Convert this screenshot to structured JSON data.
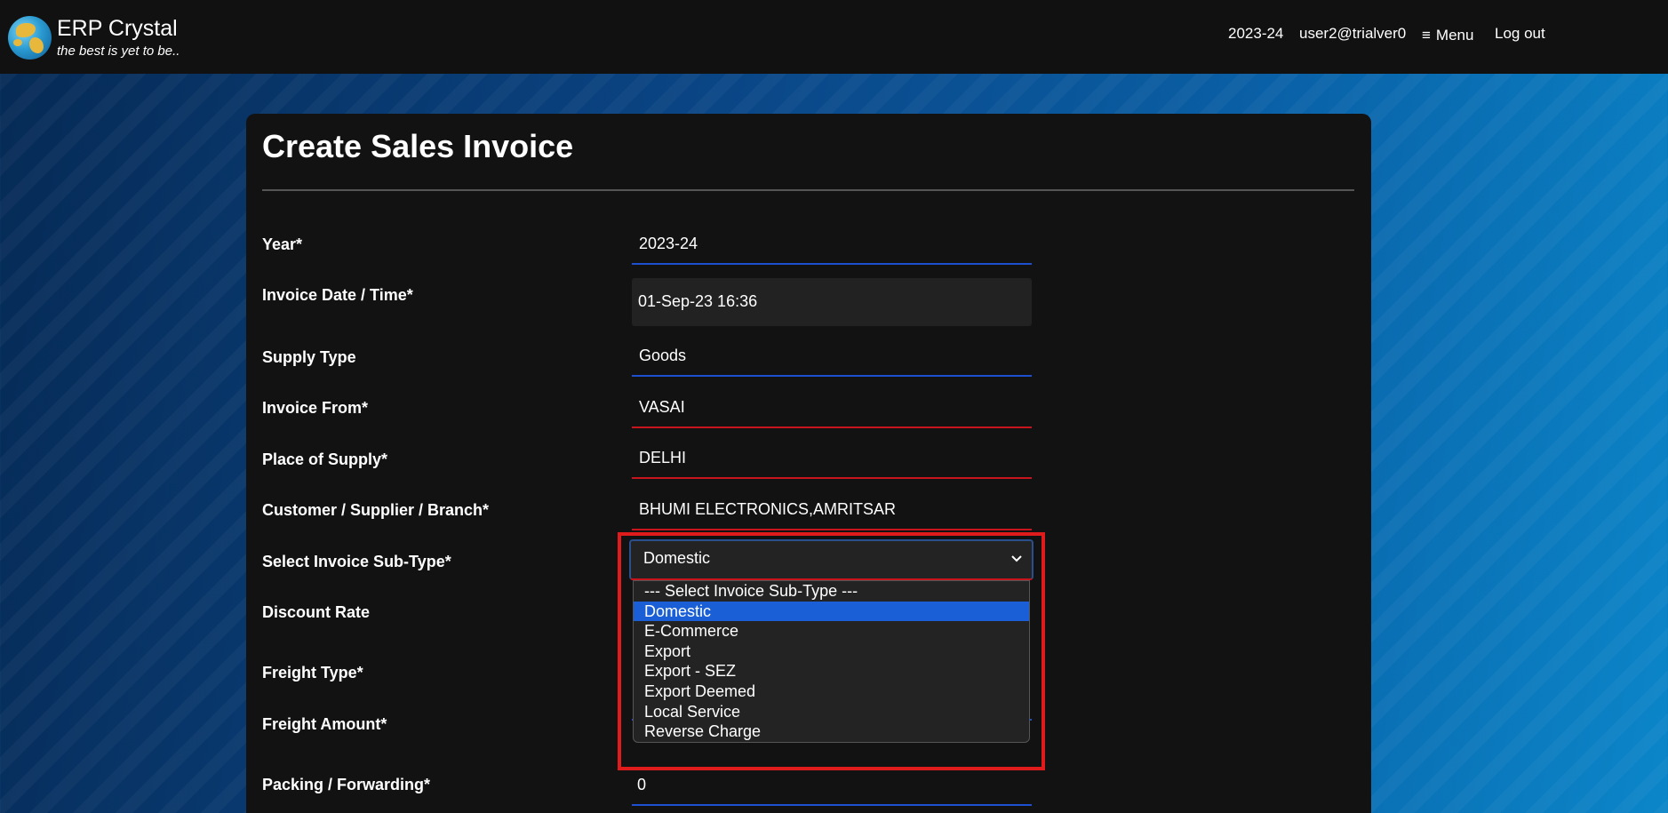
{
  "brand": {
    "name": "ERP Crystal",
    "tagline": "the best is yet to be.."
  },
  "nav": {
    "year": "2023-24",
    "user": "user2@trialver0",
    "menu_icon": "≡",
    "menu_label": "Menu",
    "logout_label": "Log out"
  },
  "form": {
    "title": "Create Sales Invoice",
    "fields": {
      "year": {
        "label": "Year*",
        "value": "2023-24"
      },
      "invoice_date": {
        "label": "Invoice Date / Time*",
        "value": "01-Sep-23 16:36"
      },
      "supply_type": {
        "label": "Supply Type",
        "value": "Goods"
      },
      "invoice_from": {
        "label": "Invoice From*",
        "value": "VASAI"
      },
      "place_of_supply": {
        "label": "Place of Supply*",
        "value": "DELHI"
      },
      "customer": {
        "label": "Customer / Supplier / Branch*",
        "value": "BHUMI ELECTRONICS,AMRITSAR"
      },
      "invoice_subtype": {
        "label": "Select Invoice Sub-Type*",
        "value": "Domestic"
      },
      "discount_rate": {
        "label": "Discount Rate"
      },
      "freight_type": {
        "label": "Freight Type*"
      },
      "freight_amount": {
        "label": "Freight Amount*"
      },
      "packing": {
        "label": "Packing / Forwarding*",
        "value": "0"
      }
    },
    "subtype_options": [
      "--- Select Invoice Sub-Type ---",
      "Domestic",
      "E-Commerce",
      "Export",
      "Export - SEZ",
      "Export Deemed",
      "Local Service",
      "Reverse Charge"
    ],
    "selected_option_index": 1
  },
  "colors": {
    "accent_blue": "#1d4fd1",
    "error_red": "#c8141c",
    "highlight_red": "#e01b1b",
    "selected_option": "#1a5fd6"
  },
  "icons": {
    "chevron": "chevron-down-icon",
    "menu": "hamburger-menu-icon",
    "logo": "globe-logo-icon"
  }
}
